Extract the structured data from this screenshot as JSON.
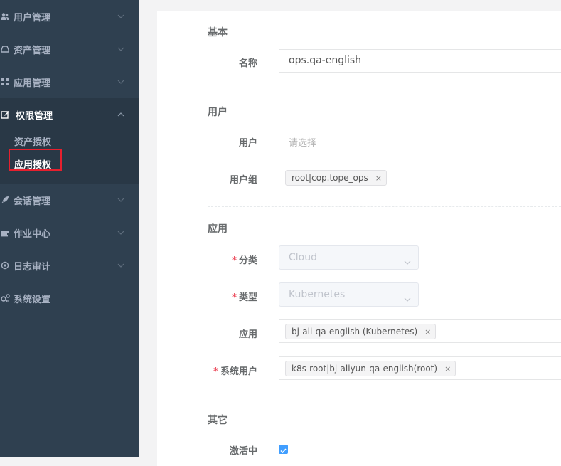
{
  "sidebar": {
    "items": [
      {
        "label": "用户管理",
        "icon": "users-icon"
      },
      {
        "label": "资产管理",
        "icon": "inbox-icon"
      },
      {
        "label": "应用管理",
        "icon": "grid-icon"
      },
      {
        "label": "权限管理",
        "icon": "edit-icon"
      },
      {
        "label": "会话管理",
        "icon": "rocket-icon"
      },
      {
        "label": "作业中心",
        "icon": "coffee-icon"
      },
      {
        "label": "日志审计",
        "icon": "dot-circle-icon"
      },
      {
        "label": "系统设置",
        "icon": "cogs-icon"
      }
    ],
    "submenu": [
      {
        "label": "资产授权"
      },
      {
        "label": "应用授权"
      }
    ]
  },
  "form": {
    "basic": {
      "title": "基本",
      "name_label": "名称",
      "name_value": "ops.qa-english"
    },
    "user": {
      "title": "用户",
      "user_label": "用户",
      "user_placeholder": "请选择",
      "group_label": "用户组",
      "group_tag": "root|cop.tope_ops"
    },
    "application": {
      "title": "应用",
      "category_label": "分类",
      "category_value": "Cloud",
      "type_label": "类型",
      "type_value": "Kubernetes",
      "app_label": "应用",
      "app_tag": "bj-ali-qa-english (Kubernetes)",
      "sysuser_label": "系统用户",
      "sysuser_tag": "k8s-root|bj-aliyun-qa-english(root)",
      "required_mark": "*"
    },
    "other": {
      "title": "其它",
      "active_label": "激活中",
      "active_checked": true
    },
    "tag_close": "×"
  },
  "colors": {
    "sidebar_bg": "#2f4050",
    "highlight": "#e6202e",
    "checkbox": "#409eff"
  }
}
